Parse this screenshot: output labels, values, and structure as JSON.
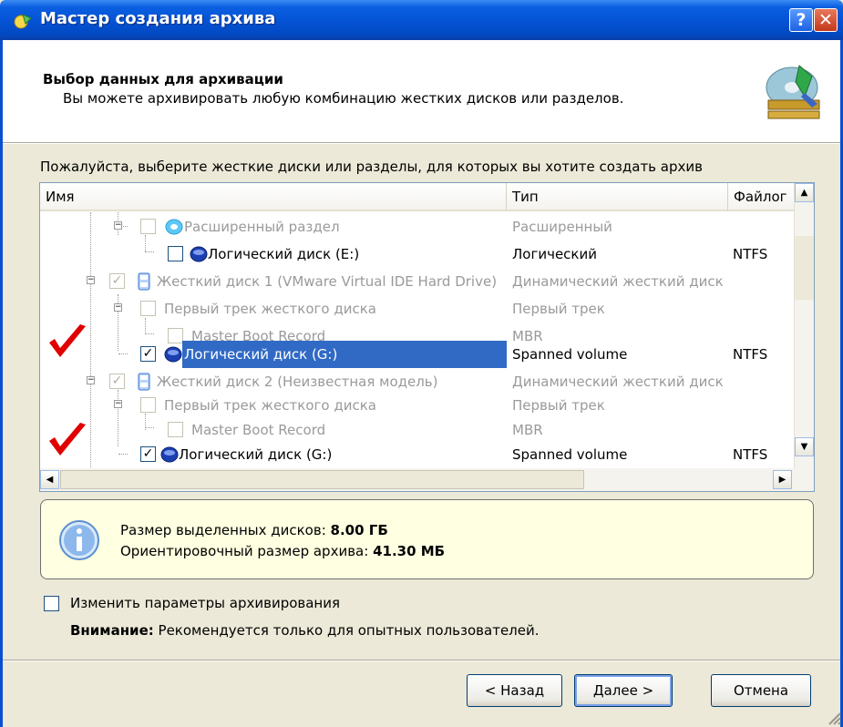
{
  "window": {
    "title": "Мастер создания архива",
    "help_label": "?",
    "close_label": "✕"
  },
  "header": {
    "title": "Выбор данных для архивации",
    "subtitle": "Вы можете архивировать любую комбинацию жестких дисков или разделов."
  },
  "prompt": "Пожалуйста, выберите жесткие диски или разделы, для которых вы хотите создать архив",
  "columns": {
    "name": "Имя",
    "type": "Тип",
    "fs": "Файлог"
  },
  "rows": [
    {
      "name": "Расширенный раздел",
      "type": "Расширенный",
      "fs": ""
    },
    {
      "name": "Логический диск (E:)",
      "type": "Логический",
      "fs": "NTFS"
    },
    {
      "name": "Жесткий диск 1 (VMware Virtual IDE Hard Drive)",
      "type": "Динамический жесткий диск",
      "fs": ""
    },
    {
      "name": "Первый трек жесткого диска",
      "type": "Первый трек",
      "fs": ""
    },
    {
      "name": "Master Boot Record",
      "type": "MBR",
      "fs": ""
    },
    {
      "name": "Логический диск (G:)",
      "type": "Spanned volume",
      "fs": "NTFS"
    },
    {
      "name": "Жесткий диск 2 (Неизвестная модель)",
      "type": "Динамический жесткий диск",
      "fs": ""
    },
    {
      "name": "Первый трек жесткого диска",
      "type": "Первый трек",
      "fs": ""
    },
    {
      "name": "Master Boot Record",
      "type": "MBR",
      "fs": ""
    },
    {
      "name": "Логический диск (G:)",
      "type": "Spanned volume",
      "fs": "NTFS"
    }
  ],
  "info": {
    "selected_label": "Размер выделенных дисков:",
    "selected_value": "8.00 ГБ",
    "estimate_label": "Ориентировочный размер архива:",
    "estimate_value": "41.30 МБ"
  },
  "options": {
    "change_params_label": "Изменить параметры архивирования",
    "warning_bold": "Внимание:",
    "warning_text": "Рекомендуется только для опытных пользователей."
  },
  "buttons": {
    "back": "< Назад",
    "next": "Далее >",
    "cancel": "Отмена"
  },
  "colors": {
    "title_bar": "#0554d6",
    "selection": "#316ac5",
    "info_bg": "#ffffe1",
    "red_check": "#e00000"
  }
}
